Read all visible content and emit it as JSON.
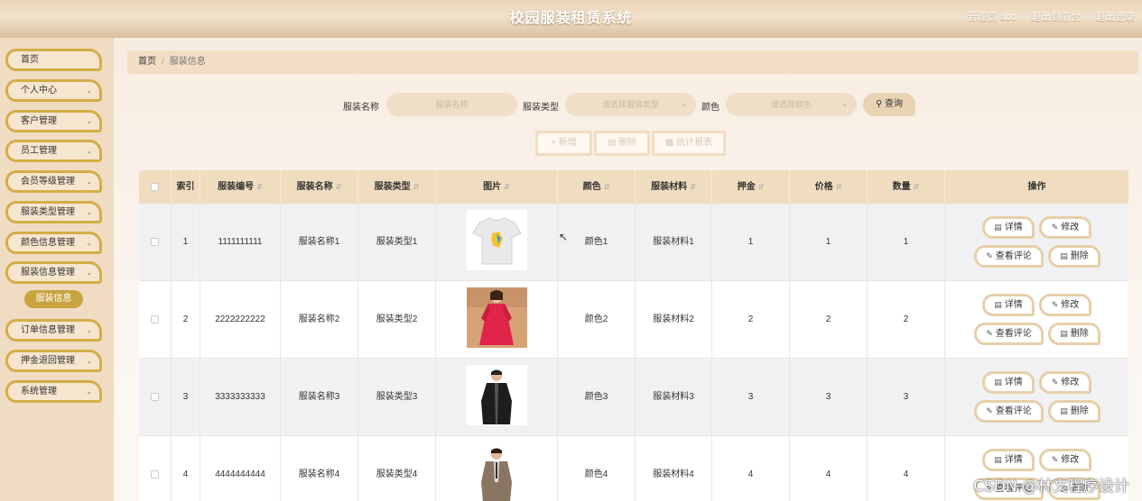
{
  "header": {
    "title": "校园服装租赁系统",
    "admin": "管理员 abo",
    "to_front": "退出到前台",
    "logout": "退出登录"
  },
  "sidebar": {
    "items": [
      {
        "label": "首页",
        "has_chevron": false
      },
      {
        "label": "个人中心",
        "has_chevron": true
      },
      {
        "label": "客户管理",
        "has_chevron": true
      },
      {
        "label": "员工管理",
        "has_chevron": true
      },
      {
        "label": "会员等级管理",
        "has_chevron": true
      },
      {
        "label": "服装类型管理",
        "has_chevron": true
      },
      {
        "label": "颜色信息管理",
        "has_chevron": true
      },
      {
        "label": "服装信息管理",
        "has_chevron": true
      },
      {
        "label": "订单信息管理",
        "has_chevron": true
      },
      {
        "label": "押金退回管理",
        "has_chevron": true
      },
      {
        "label": "系统管理",
        "has_chevron": true
      }
    ],
    "active_sub": "服装信息"
  },
  "breadcrumb": {
    "home": "首页",
    "sep": "/",
    "current": "服装信息"
  },
  "search": {
    "name_label": "服装名称",
    "name_placeholder": "服装名称",
    "type_label": "服装类型",
    "type_placeholder": "请选择服装类型",
    "color_label": "颜色",
    "color_placeholder": "请选择颜色",
    "query": "查询"
  },
  "actions": {
    "add": "新增",
    "delete": "删除",
    "stats": "统计报表"
  },
  "table": {
    "headers": [
      "索引",
      "服装编号",
      "服装名称",
      "服装类型",
      "图片",
      "颜色",
      "服装材料",
      "押金",
      "价格",
      "数量",
      "操作"
    ],
    "rows": [
      {
        "index": "1",
        "code": "1111111111",
        "name": "服装名称1",
        "type": "服装类型1",
        "color": "颜色1",
        "material": "服装材料1",
        "deposit": "1",
        "price": "1",
        "qty": "1"
      },
      {
        "index": "2",
        "code": "2222222222",
        "name": "服装名称2",
        "type": "服装类型2",
        "color": "颜色2",
        "material": "服装材料2",
        "deposit": "2",
        "price": "2",
        "qty": "2"
      },
      {
        "index": "3",
        "code": "3333333333",
        "name": "服装名称3",
        "type": "服装类型3",
        "color": "颜色3",
        "material": "服装材料3",
        "deposit": "3",
        "price": "3",
        "qty": "3"
      },
      {
        "index": "4",
        "code": "4444444444",
        "name": "服装名称4",
        "type": "服装类型4",
        "color": "颜色4",
        "material": "服装材料4",
        "deposit": "4",
        "price": "4",
        "qty": "4"
      }
    ],
    "ops": {
      "detail": "详情",
      "edit": "修改",
      "comments": "查看评论",
      "delete": "删除"
    }
  },
  "watermark": "CSDN @林文程序设计",
  "colors": {
    "accent": "#d3ad48",
    "active_sub": "#c9a33f",
    "header": "#e8d3b6",
    "table_head": "#f0dcbf"
  }
}
